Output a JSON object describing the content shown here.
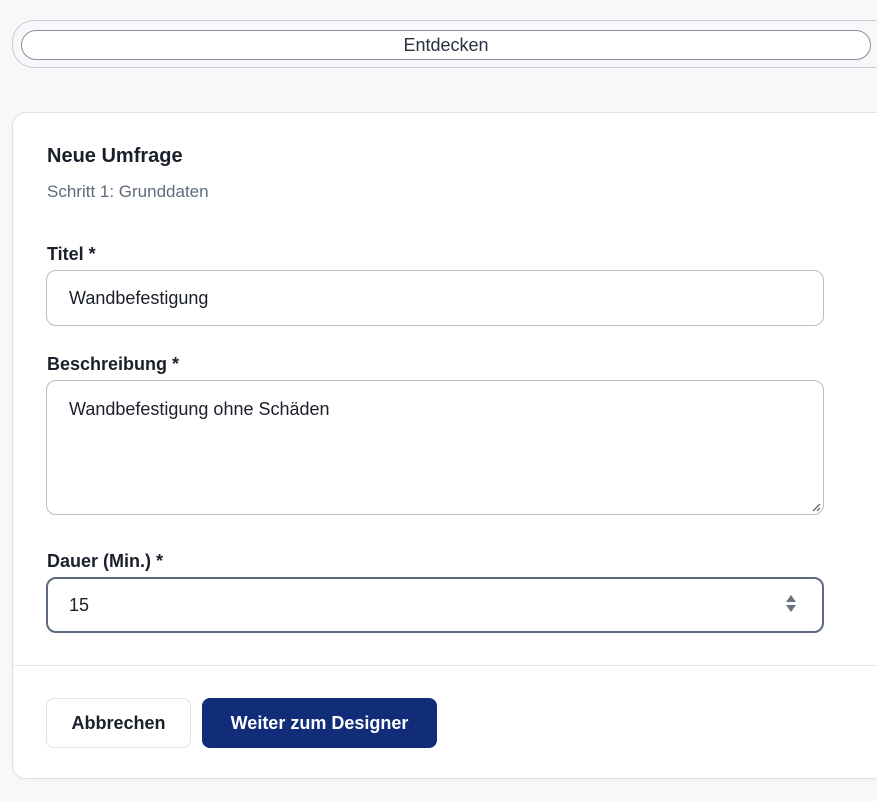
{
  "nav": {
    "tab_label": "Entdecken"
  },
  "form": {
    "title": "Neue Umfrage",
    "subtitle": "Schritt 1: Grunddaten",
    "title_field": {
      "label": "Titel *",
      "value": "Wandbefestigung"
    },
    "description_field": {
      "label": "Beschreibung *",
      "value": "Wandbefestigung ohne Schäden"
    },
    "duration_field": {
      "label": "Dauer (Min.) *",
      "value": "15"
    }
  },
  "actions": {
    "cancel_label": "Abbrechen",
    "next_label": "Weiter zum Designer"
  },
  "colors": {
    "primary": "#112d7a",
    "background": "#f7f8fa"
  }
}
